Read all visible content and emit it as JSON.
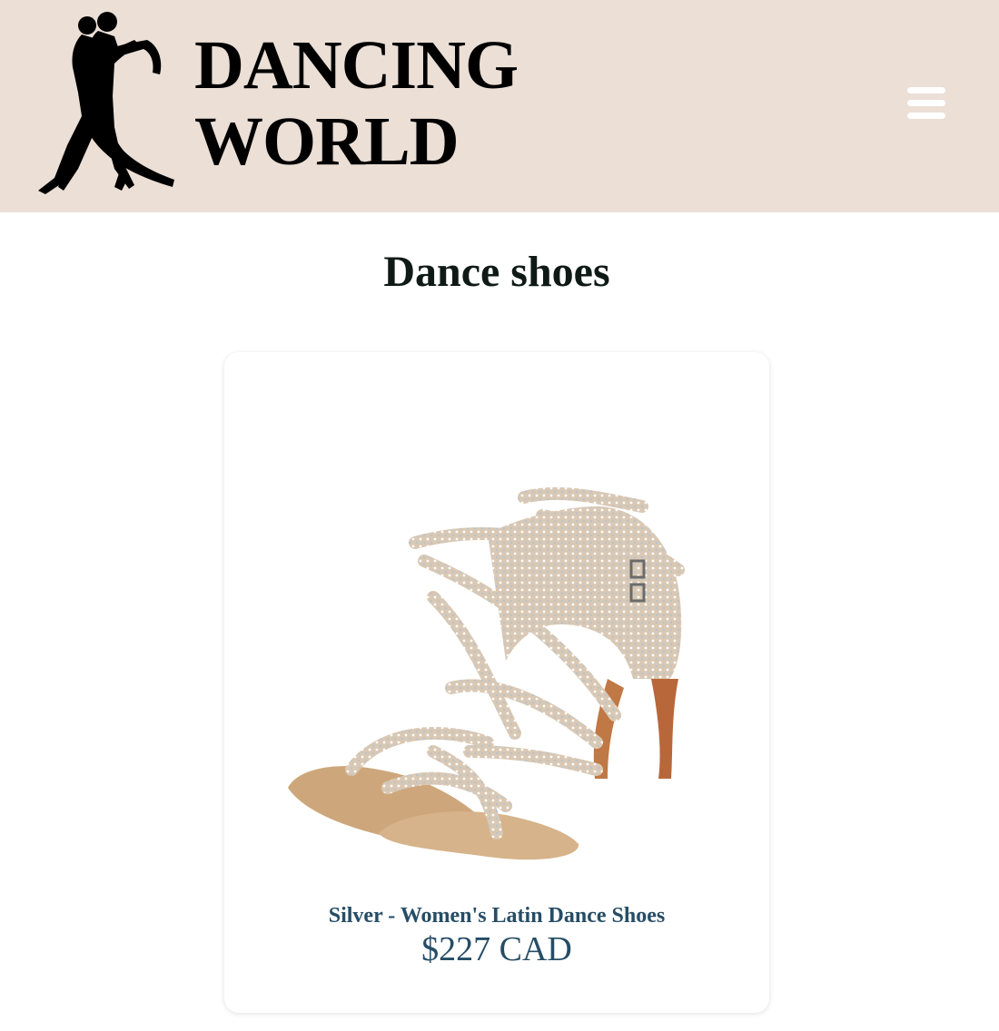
{
  "header": {
    "brand_line1": "DANCING",
    "brand_line2": "WORLD",
    "logo_icon": "dancing-couple-silhouette",
    "menu_icon": "hamburger-menu-icon",
    "background": "#ebdfd6"
  },
  "main": {
    "title": "Dance shoes"
  },
  "products": [
    {
      "name": "Silver - Women's Latin Dance Shoes",
      "price": "$227 CAD",
      "image": "rhinestone-latin-sandal"
    }
  ],
  "colors": {
    "title": "#0f1a16",
    "product_text": "#264d66",
    "menu_icon": "#ffffff"
  }
}
